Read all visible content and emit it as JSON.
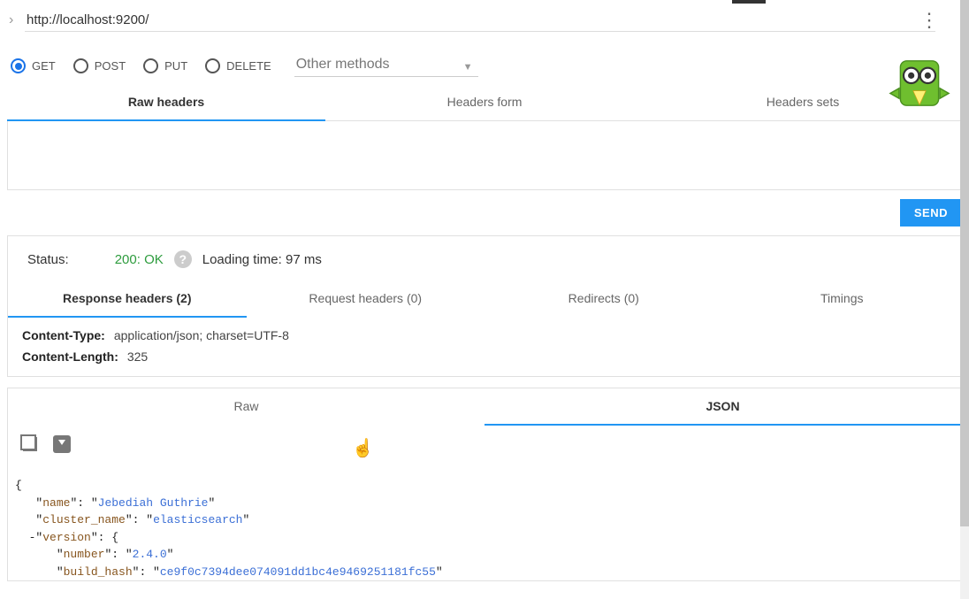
{
  "url": "http://localhost:9200/",
  "methods": {
    "get": "GET",
    "post": "POST",
    "put": "PUT",
    "delete": "DELETE",
    "other_label": "Other methods"
  },
  "header_tabs": {
    "raw": "Raw headers",
    "form": "Headers form",
    "sets": "Headers sets"
  },
  "send_label": "SEND",
  "status": {
    "label": "Status:",
    "code": "200: OK",
    "loading_label": "Loading time:",
    "loading_value": "97 ms"
  },
  "status_tabs": {
    "response": "Response headers (2)",
    "request": "Request headers (0)",
    "redirects": "Redirects (0)",
    "timings": "Timings"
  },
  "resp_headers": [
    {
      "k": "Content-Type:",
      "v": "application/json; charset=UTF-8"
    },
    {
      "k": "Content-Length:",
      "v": "325"
    }
  ],
  "body_tabs": {
    "raw": "Raw",
    "json": "JSON"
  },
  "json": {
    "k_name": "name",
    "v_name": "Jebediah Guthrie",
    "k_cluster": "cluster_name",
    "v_cluster": "elasticsearch",
    "k_version": "version",
    "k_number": "number",
    "v_number": "2.4.0",
    "k_build": "build_hash",
    "v_build": "ce9f0c7394dee074091dd1bc4e9469251181fc55"
  }
}
